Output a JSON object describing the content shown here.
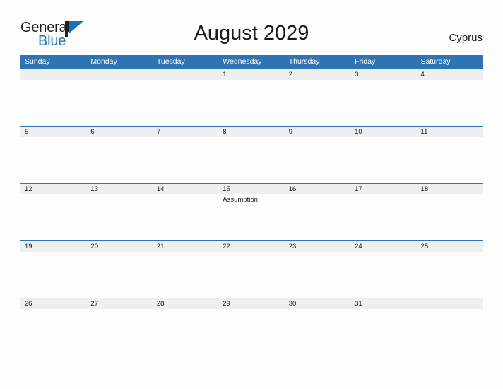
{
  "brand": {
    "name_part1": "General",
    "name_part2": "Blue",
    "flag_icon": "blue-triangle-flag-icon",
    "colors": {
      "black": "#231f20",
      "blue": "#1b72b8"
    }
  },
  "header": {
    "title": "August 2029",
    "country": "Cyprus"
  },
  "theme": {
    "header_blue": "#2e74b5",
    "row_band_gray": "#efefef",
    "page_background": "#fdfdfd",
    "text": "#1a1a1a"
  },
  "calendar": {
    "month": "August",
    "year": "2029",
    "weekday_headers": [
      "Sunday",
      "Monday",
      "Tuesday",
      "Wednesday",
      "Thursday",
      "Friday",
      "Saturday"
    ],
    "weeks": [
      {
        "days": [
          {
            "num": "",
            "event": ""
          },
          {
            "num": "",
            "event": ""
          },
          {
            "num": "",
            "event": ""
          },
          {
            "num": "1",
            "event": ""
          },
          {
            "num": "2",
            "event": ""
          },
          {
            "num": "3",
            "event": ""
          },
          {
            "num": "4",
            "event": ""
          }
        ]
      },
      {
        "days": [
          {
            "num": "5",
            "event": ""
          },
          {
            "num": "6",
            "event": ""
          },
          {
            "num": "7",
            "event": ""
          },
          {
            "num": "8",
            "event": ""
          },
          {
            "num": "9",
            "event": ""
          },
          {
            "num": "10",
            "event": ""
          },
          {
            "num": "11",
            "event": ""
          }
        ]
      },
      {
        "days": [
          {
            "num": "12",
            "event": ""
          },
          {
            "num": "13",
            "event": ""
          },
          {
            "num": "14",
            "event": ""
          },
          {
            "num": "15",
            "event": "Assumption"
          },
          {
            "num": "16",
            "event": ""
          },
          {
            "num": "17",
            "event": ""
          },
          {
            "num": "18",
            "event": ""
          }
        ]
      },
      {
        "days": [
          {
            "num": "19",
            "event": ""
          },
          {
            "num": "20",
            "event": ""
          },
          {
            "num": "21",
            "event": ""
          },
          {
            "num": "22",
            "event": ""
          },
          {
            "num": "23",
            "event": ""
          },
          {
            "num": "24",
            "event": ""
          },
          {
            "num": "25",
            "event": ""
          }
        ]
      },
      {
        "days": [
          {
            "num": "26",
            "event": ""
          },
          {
            "num": "27",
            "event": ""
          },
          {
            "num": "28",
            "event": ""
          },
          {
            "num": "29",
            "event": ""
          },
          {
            "num": "30",
            "event": ""
          },
          {
            "num": "31",
            "event": ""
          },
          {
            "num": "",
            "event": ""
          }
        ]
      }
    ]
  }
}
